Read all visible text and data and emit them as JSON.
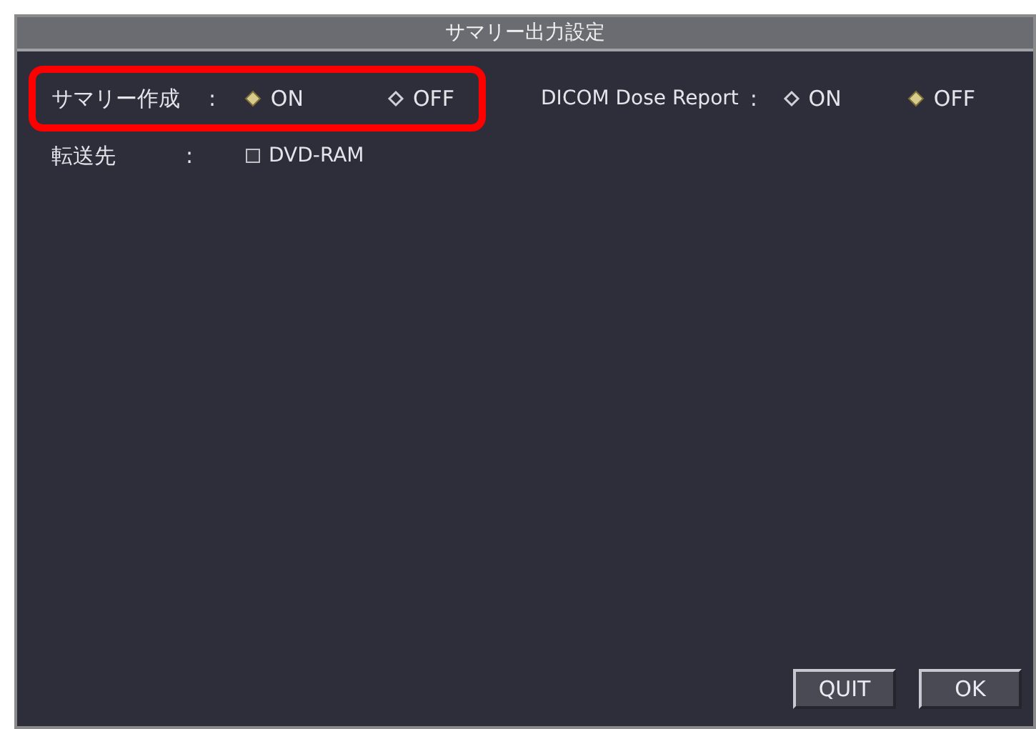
{
  "window": {
    "title": "サマリー出力設定"
  },
  "summary": {
    "label": "サマリー作成",
    "colon": ":",
    "options": [
      {
        "label": "ON",
        "selected": true
      },
      {
        "label": "OFF",
        "selected": false
      }
    ]
  },
  "dicom": {
    "label": "DICOM Dose Report",
    "colon": ":",
    "options": [
      {
        "label": "ON",
        "selected": false
      },
      {
        "label": "OFF",
        "selected": true
      }
    ]
  },
  "destination": {
    "label": "転送先",
    "colon": ":",
    "checkbox": {
      "label": "DVD-RAM",
      "checked": false
    }
  },
  "buttons": [
    "QUIT",
    "OK"
  ]
}
